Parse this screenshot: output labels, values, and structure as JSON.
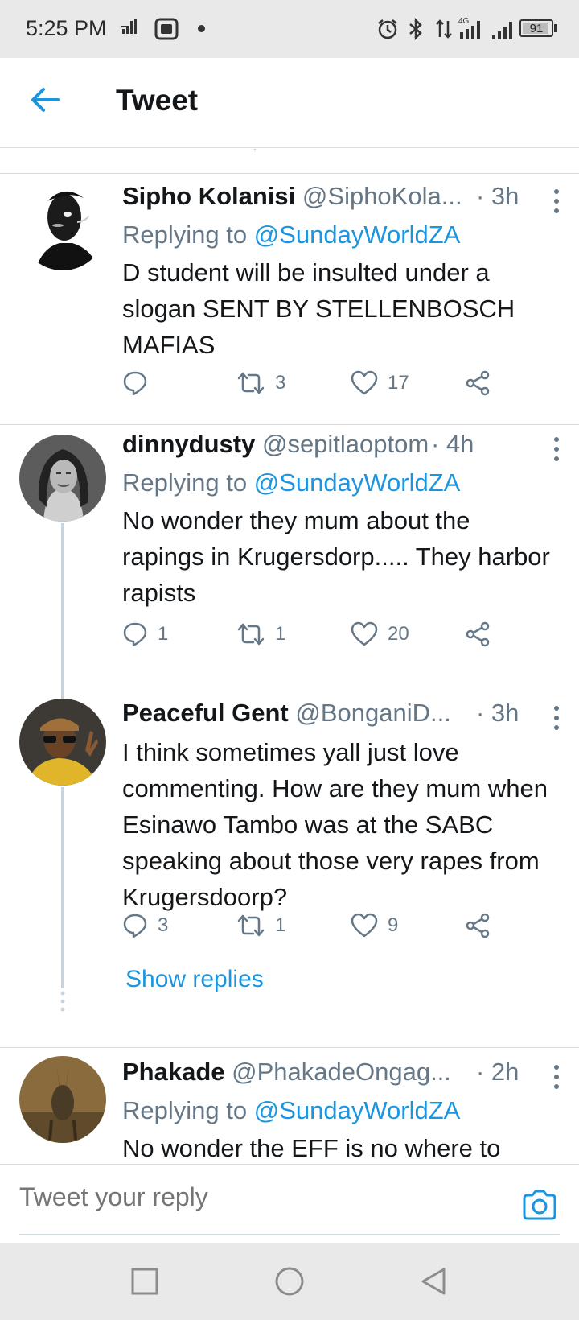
{
  "status_bar": {
    "time": "5:25 PM",
    "battery": "91"
  },
  "header": {
    "title": "Tweet"
  },
  "tweets": [
    {
      "name": "Sipho Kolanisi",
      "handle": "@SiphoKola...",
      "time": "· 3h",
      "replying_prefix": "Replying to ",
      "replying_to": "@SundayWorldZA",
      "text": "D student will be insulted under a slogan SENT BY STELLENBOSCH MAFIAS",
      "replies": "",
      "retweets": "3",
      "likes": "17"
    },
    {
      "name": "dinnydusty",
      "handle": "@sepitlaoptom",
      "time": "· 4h",
      "replying_prefix": "Replying to ",
      "replying_to": "@SundayWorldZA",
      "text": "No wonder they mum about the rapings in Krugersdorp..... They harbor rapists",
      "replies": "1",
      "retweets": "1",
      "likes": "20"
    },
    {
      "name": "Peaceful Gent",
      "handle": "@BonganiD...",
      "time": "· 3h",
      "text": "I think sometimes yall just love commenting. How are they mum when Esinawo Tambo was at the SABC speaking about those very rapes from Krugersdoorp?",
      "replies": "3",
      "retweets": "1",
      "likes": "9"
    },
    {
      "name": "Phakade",
      "handle": "@PhakadeOngag...",
      "time": "· 2h",
      "replying_prefix": "Replying to ",
      "replying_to": "@SundayWorldZA",
      "text": "No wonder the EFF is no where to"
    }
  ],
  "show_replies": "Show replies",
  "reply_bar": {
    "placeholder": "Tweet your reply"
  },
  "icons": {
    "back": "arrow-left-icon",
    "more": "kebab-menu-icon",
    "reply": "speech-bubble-icon",
    "retweet": "retweet-icon",
    "like": "heart-icon",
    "share": "share-icon",
    "camera": "camera-icon"
  },
  "colors": {
    "accent": "#1b95e0",
    "secondary_text": "#657786",
    "divider": "#d5dce1"
  }
}
